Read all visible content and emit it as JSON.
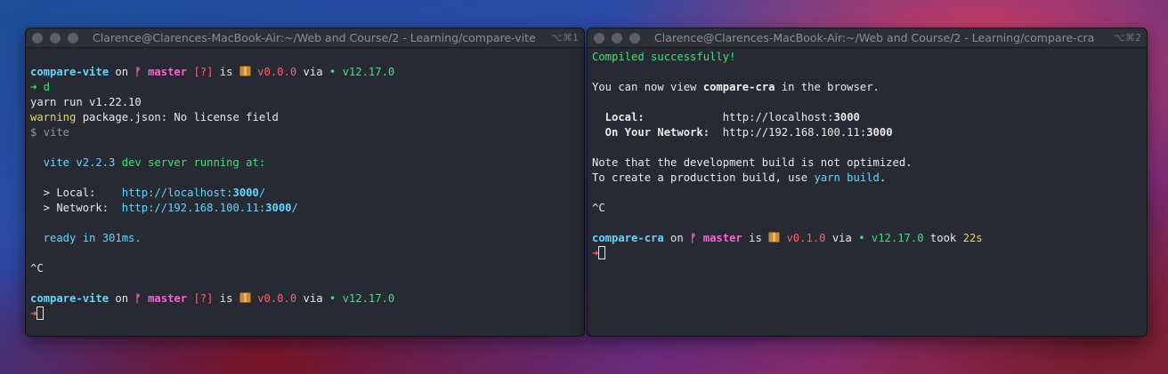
{
  "left": {
    "title": "Clarence@Clarences-MacBook-Air:~/Web and Course/2 - Learning/compare-vite",
    "shortcut": "⌥⌘1",
    "prompt": {
      "dir": "compare-vite",
      "on": " on ",
      "branch_icon": "ᚠ",
      "branch": " master",
      "status": " [?]",
      "is": " is ",
      "version": " v0.0.0",
      "via": " via ",
      "node_dot": "•",
      "node_version": " v12.17.0"
    },
    "arrow": "➜",
    "cmd": " d",
    "yarn_run": "yarn run v1.22.10",
    "warning_label": "warning",
    "warning_text": " package.json: No license field",
    "vite_cmd": "$ vite",
    "vite_ver": "  vite v2.2.3",
    "vite_running": " dev server running at:",
    "local_label": "  > Local:    ",
    "local_url_a": "http://localhost:",
    "local_port": "3000",
    "local_url_b": "/",
    "network_label": "  > Network:  ",
    "network_url_a": "http://192.168.100.11:",
    "network_port": "3000",
    "network_url_b": "/",
    "ready": "  ready in 301ms.",
    "ctrl_c": "^C",
    "cursor_arrow": "➜"
  },
  "right": {
    "title": "Clarence@Clarences-MacBook-Air:~/Web and Course/2 - Learning/compare-cra",
    "shortcut": "⌥⌘2",
    "compiled": "Compiled successfully!",
    "view_a": "You can now view ",
    "view_app": "compare-cra",
    "view_b": " in the browser.",
    "local_label": "  Local:",
    "local_pad": "            ",
    "local_url": "http://localhost:",
    "local_port": "3000",
    "network_label": "  On Your Network:",
    "network_pad": "  ",
    "network_url": "http://192.168.100.11:",
    "network_port": "3000",
    "note1": "Note that the development build is not optimized.",
    "note2_a": "To create a production build, use ",
    "note2_cmd": "yarn build",
    "note2_b": ".",
    "ctrl_c": "^C",
    "prompt": {
      "dir": "compare-cra",
      "on": " on ",
      "branch_icon": "ᚠ",
      "branch": " master",
      "is": " is ",
      "version": " v0.1.0",
      "via": " via ",
      "node_dot": "•",
      "node_version": " v12.17.0",
      "took": " took ",
      "duration": "22s"
    },
    "cursor_arrow": "➜"
  }
}
